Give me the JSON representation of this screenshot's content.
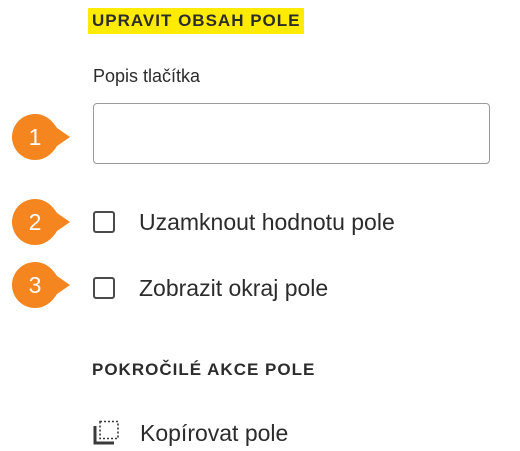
{
  "edit_section": {
    "title": "UPRAVIT OBSAH POLE",
    "field_label": "Popis tlačítka",
    "field_value": "",
    "field_placeholder": ""
  },
  "options": [
    {
      "label": "Uzamknout hodnotu pole",
      "checked": false
    },
    {
      "label": "Zobrazit okraj pole",
      "checked": false
    }
  ],
  "callouts": [
    "1",
    "2",
    "3"
  ],
  "callout_color": "#f5851f",
  "highlight_color": "#ffeb00",
  "advanced_section": {
    "title": "POKROČILÉ AKCE POLE",
    "actions": [
      {
        "label": "Kopírovat pole",
        "icon": "copy-field-icon"
      }
    ]
  }
}
